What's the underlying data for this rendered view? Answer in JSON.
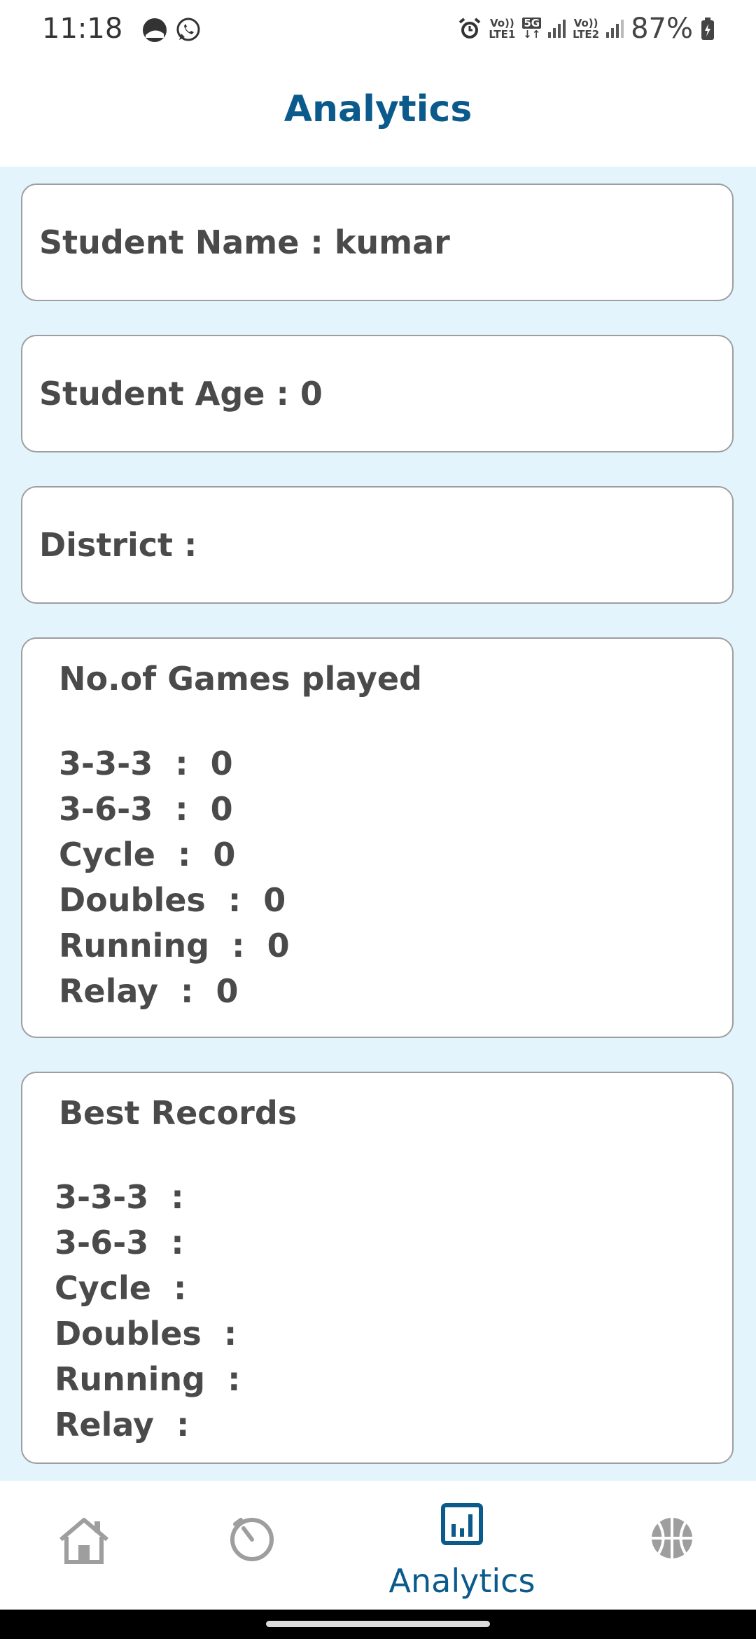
{
  "status_bar": {
    "time": "11:18",
    "network1": [
      "Vo))",
      "LTE1"
    ],
    "network_5g": "5G",
    "network2": [
      "Vo))",
      "LTE2"
    ],
    "battery": "87%"
  },
  "header": {
    "title": "Analytics"
  },
  "student": {
    "name_label": "Student Name : kumar",
    "age_label": "Student Age : 0",
    "district_label": "District :"
  },
  "games_played": {
    "title": "No.of Games played",
    "items": [
      "3-3-3  :  0",
      "3-6-3  :  0",
      "Cycle  :  0",
      "Doubles  :  0",
      "Running  :  0",
      "Relay  :  0"
    ]
  },
  "best_records": {
    "title": "Best Records",
    "items": [
      "3-3-3  :",
      "3-6-3  :",
      "Cycle  :",
      "Doubles  :",
      "Running  :",
      "Relay  :"
    ]
  },
  "bottom_nav": {
    "items": [
      {
        "icon": "home-icon",
        "label": ""
      },
      {
        "icon": "timer-icon",
        "label": ""
      },
      {
        "icon": "analytics-icon",
        "label": "Analytics",
        "active": true
      },
      {
        "icon": "basketball-icon",
        "label": ""
      }
    ]
  },
  "colors": {
    "accent": "#0a5a8c",
    "content_background": "#e3f4fc",
    "inactive_icon": "#9e9e9e"
  }
}
